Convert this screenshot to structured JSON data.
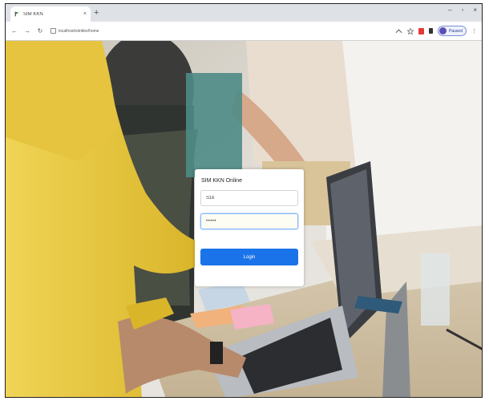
{
  "browser": {
    "tab_title": "SIM KKN",
    "tab_close": "×",
    "new_tab": "+",
    "window_controls": {
      "minimize": "–",
      "maximize": "▫",
      "close": "×"
    },
    "nav": {
      "back": "←",
      "forward": "→",
      "reload": "↻"
    },
    "address": "localhost/simkkn/home",
    "toolbar_icons": [
      "share-icon",
      "star-icon",
      "extension-icon",
      "puzzle-icon"
    ],
    "profile_label": "Paused",
    "menu": "⋮"
  },
  "login": {
    "title": "SIM KKN Online",
    "username_value": "S1k",
    "password_value": "•••••",
    "button_label": "Login"
  },
  "colors": {
    "accent": "#1a73e8",
    "focus_border": "#86b7fe",
    "shirt_yellow": "#e8c53a"
  },
  "icons": {
    "favicon": "flag-favicon-icon",
    "lock": "lock-icon"
  }
}
